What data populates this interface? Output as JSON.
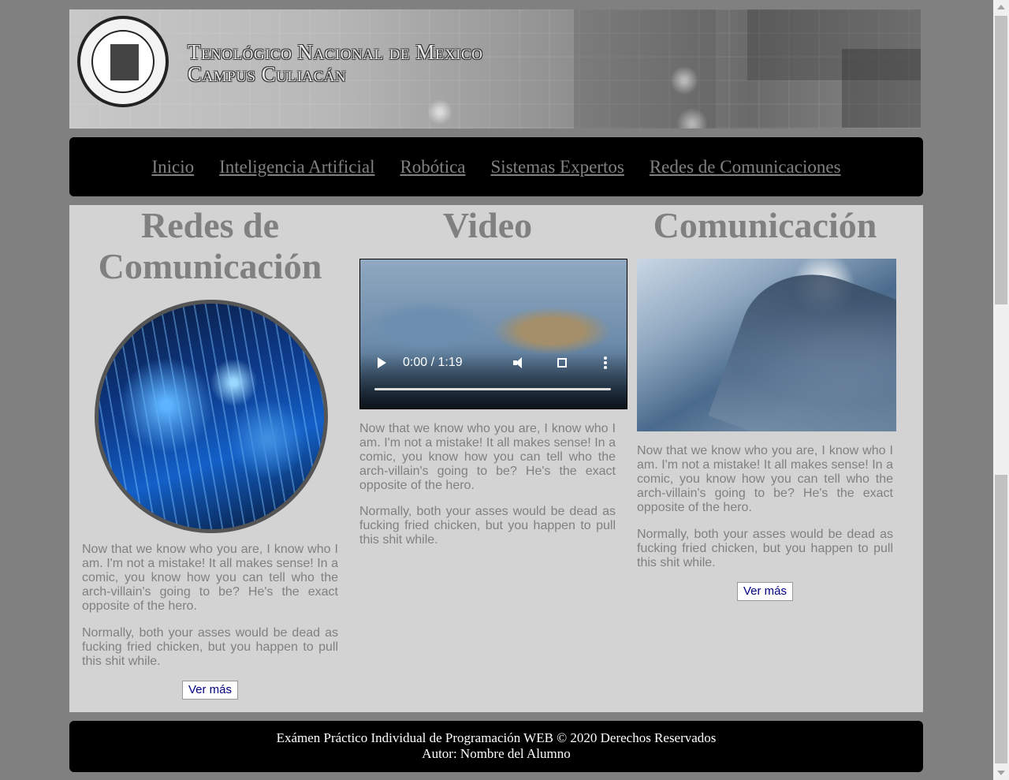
{
  "header": {
    "institution_line1": "Tenológico Nacional de Mexico",
    "institution_line2": "Campus Culiacán"
  },
  "nav": {
    "items": [
      {
        "label": "Inicio"
      },
      {
        "label": "Inteligencia Artificial"
      },
      {
        "label": "Robótica"
      },
      {
        "label": "Sistemas Expertos"
      },
      {
        "label": "Redes de Comunicaciones"
      }
    ]
  },
  "columns": [
    {
      "title_line1": "Redes de",
      "title_line2": "Comunicación",
      "paragraph1": "Now that we know who you are, I know who I am. I'm not a mistake! It all makes sense! In a comic, you know how you can tell who the arch-villain's going to be? He's the exact opposite of the hero.",
      "paragraph2": "Normally, both your asses would be dead as fucking fried chicken, but you happen to pull this shit while.",
      "button": "Ver más"
    },
    {
      "title": "Video",
      "video_time": "0:00 / 1:19",
      "paragraph1": "Now that we know who you are, I know who I am. I'm not a mistake! It all makes sense! In a comic, you know how you can tell who the arch-villain's going to be? He's the exact opposite of the hero.",
      "paragraph2": "Normally, both your asses would be dead as fucking fried chicken, but you happen to pull this shit while."
    },
    {
      "title": "Comunicación",
      "paragraph1": "Now that we know who you are, I know who I am. I'm not a mistake! It all makes sense! In a comic, you know how you can tell who the arch-villain's going to be? He's the exact opposite of the hero.",
      "paragraph2": "Normally, both your asses would be dead as fucking fried chicken, but you happen to pull this shit while.",
      "button": "Ver más"
    }
  ],
  "footer": {
    "line1": "Exámen Práctico Individual de Programación WEB © 2020 Derechos Reservados",
    "line2": "Autor: Nombre del Alumno"
  },
  "colors": {
    "page_bg": "#808080",
    "content_bg": "#d3d3d3",
    "bar_bg": "#000000",
    "heading": "#808080",
    "button_text": "#000080"
  },
  "icons": [
    "institution-seal-icon",
    "play-icon",
    "volume-icon",
    "fullscreen-icon",
    "more-options-icon"
  ]
}
